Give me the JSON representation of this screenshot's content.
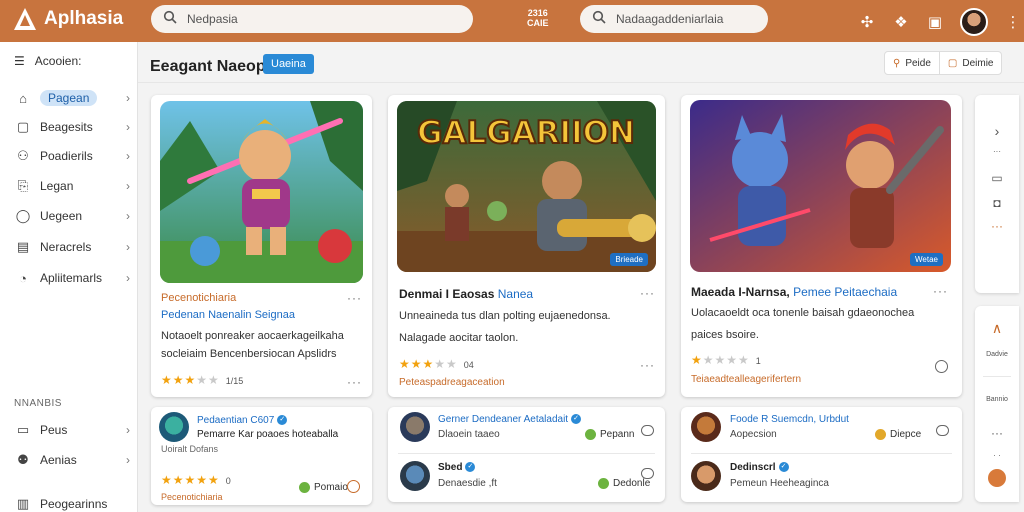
{
  "app": {
    "name": "Aplhasia"
  },
  "topbar": {
    "search_main": {
      "value": "Nedpasia",
      "placeholder": ""
    },
    "date_chip": {
      "line1": "2316",
      "line2": "CAIE"
    },
    "search_secondary": {
      "value": "Nadaagaddeniarlaia",
      "placeholder": ""
    },
    "icons": [
      "puzzle-icon",
      "gift-icon",
      "chat-icon",
      "user-avatar",
      "settings-icon"
    ]
  },
  "sidebar": {
    "header_label": "Acooien:",
    "items": [
      {
        "label": "Pagean",
        "icon": "home-icon",
        "active": true
      },
      {
        "label": "Beagesits",
        "icon": "briefcase-icon",
        "active": false
      },
      {
        "label": "Poadierils",
        "icon": "users-icon",
        "active": false
      },
      {
        "label": "Legan",
        "icon": "login-icon",
        "active": false
      },
      {
        "label": "Uegeen",
        "icon": "chat-icon",
        "active": false
      },
      {
        "label": "Neracrels",
        "icon": "calendar-icon",
        "active": false
      },
      {
        "label": "Apliitemarls",
        "icon": "apps-icon",
        "active": false
      }
    ],
    "section_label": "NNANBIS",
    "bottom_items": [
      {
        "label": "Peus",
        "icon": "list-icon"
      },
      {
        "label": "Aenias",
        "icon": "team-icon"
      },
      {
        "label": "Peogearinns",
        "icon": "program-icon"
      }
    ]
  },
  "header": {
    "title": "Eeagant Naeopla",
    "badge": "Uaeina",
    "btn_search": "Peide",
    "btn_filter": "Deimie"
  },
  "cards": [
    {
      "subtitle": "Pecenotichiaria",
      "subtitle2": "Pedenan Naenalin Seignaa",
      "desc1": "Notaoelt ponreaker aocaerkageilkaha",
      "desc2": "socleiaim Bencenbersiocan Apslidrs",
      "rating": 3,
      "rating_text": "1/15",
      "tag": "",
      "badge": ""
    },
    {
      "title_bold": "Denmai I Eaosas",
      "title_blue": "Nanea",
      "desc1": "Unneaineda tus dlan polting eujaenedonsa.",
      "desc2": "Nalagade aocitar taolon.",
      "rating": 3,
      "rating_text": "04",
      "tag": "Peteaspadreagaceation",
      "badge": "Brieade",
      "art_title": "GALGARIION"
    },
    {
      "title_bold": "Maeada I-Narnsa,",
      "title_blue": "Pemee Peitaechaia",
      "desc1": "Uolacaoeldt oca tonenle baisah gdaeonochea",
      "desc2": "paices bsoire.",
      "rating": 1,
      "rating_text": "1",
      "tag": "Teiaeadtealleagerifertern",
      "badge": "Wetae"
    }
  ],
  "mini_cards": [
    {
      "name": "Pedaentian C607",
      "text1": "Pemarre Kar poaoes hoteaballa",
      "text2": "Uoiralt Dofans",
      "rating": 5,
      "rating_text": "0",
      "action": "Pomaio"
    },
    {
      "name": "Gerner Dendeaner Aetaladait",
      "text1": "Dlaoein taaeo",
      "action": "Pepann",
      "name2": "Sbed",
      "text2": "Denaesdie ,ft",
      "action2": "Dedonle"
    },
    {
      "name": "Foode R Suemcdn, Urbdut",
      "text1": "Aopecsion",
      "action": "Diepce",
      "name2": "Dedinscrl",
      "text2": "Pemeun Heeheaginca"
    }
  ],
  "rail": {
    "labels": [
      "Dadvie",
      "Bannio"
    ]
  },
  "colors": {
    "topbar": "#c8743e",
    "accent": "#2a8ad6",
    "star": "#f2a20f",
    "subtitle": "#c76b2a"
  }
}
